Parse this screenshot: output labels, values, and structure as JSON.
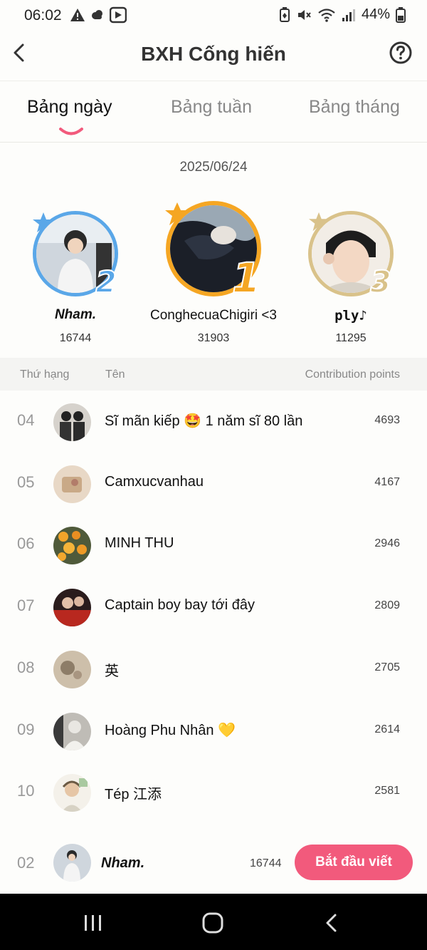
{
  "status": {
    "time": "06:02",
    "battery": "44%",
    "left_icons": [
      "warning-icon",
      "cloud-icon",
      "cast-app-icon"
    ],
    "right_icons": [
      "battery-saver-icon",
      "mute-icon",
      "wifi-icon",
      "signal-icon",
      "battery-icon"
    ]
  },
  "header": {
    "title": "BXH Cống hiến",
    "back_icon": "chevron-left-icon",
    "help_icon": "help-circle-icon"
  },
  "tabs": [
    {
      "label": "Bảng ngày",
      "active": true
    },
    {
      "label": "Bảng tuần",
      "active": false
    },
    {
      "label": "Bảng tháng",
      "active": false
    }
  ],
  "date": "2025/06/24",
  "podium": {
    "first": {
      "rank": "1",
      "name": "ConghecuaChigiri <3",
      "points": "31903",
      "ring_color": "#f5a623"
    },
    "second": {
      "rank": "2",
      "name": "Nham.",
      "points": "16744",
      "ring_color": "#5aa7e8"
    },
    "third": {
      "rank": "3",
      "name": "ply♪",
      "points": "11295",
      "ring_color": "#d9c28a"
    }
  },
  "table": {
    "col_rank": "Thứ hạng",
    "col_name": "Tên",
    "col_points": "Contribution points"
  },
  "rows": [
    {
      "rank": "04",
      "name": "Sĩ mãn kiếp 🤩 1 năm sĩ 80 lần",
      "points": "4693"
    },
    {
      "rank": "05",
      "name": "Camxucvanhau",
      "points": "4167"
    },
    {
      "rank": "06",
      "name": "MINH THU",
      "points": "2946"
    },
    {
      "rank": "07",
      "name": "Captain boy bay tới đây",
      "points": "2809"
    },
    {
      "rank": "08",
      "name": "英",
      "points": "2705"
    },
    {
      "rank": "09",
      "name": "Hoàng Phu Nhân 💛",
      "points": "2614"
    },
    {
      "rank": "10",
      "name": "Tép 江添",
      "points": "2581"
    }
  ],
  "me": {
    "rank": "02",
    "name": "Nham.",
    "points": "16744",
    "button_label": "Bắt đầu viết"
  },
  "colors": {
    "accent": "#f25a7c",
    "background": "#fdfdfb"
  },
  "nav": {
    "icons": [
      "recent-apps-icon",
      "home-icon",
      "back-icon"
    ]
  }
}
